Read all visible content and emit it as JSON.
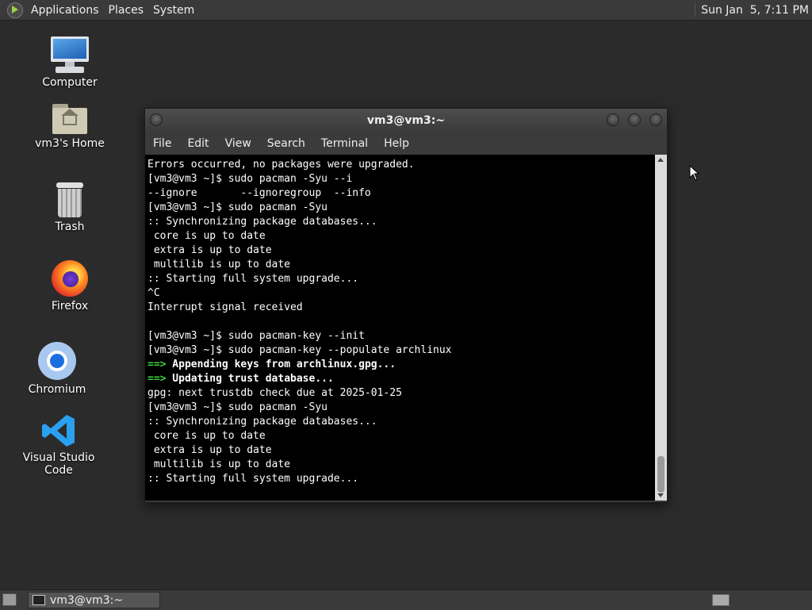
{
  "top_panel": {
    "menus": [
      "Applications",
      "Places",
      "System"
    ],
    "clock": "Sun Jan  5, 7:11 PM"
  },
  "desktop_icons": {
    "computer": "Computer",
    "home": "vm3's Home",
    "trash": "Trash",
    "firefox": "Firefox",
    "chromium": "Chromium",
    "vscode": "Visual Studio Code"
  },
  "terminal": {
    "title": "vm3@vm3:~",
    "menu": [
      "File",
      "Edit",
      "View",
      "Search",
      "Terminal",
      "Help"
    ],
    "lines": [
      {
        "text": "Errors occurred, no packages were upgraded."
      },
      {
        "text": "[vm3@vm3 ~]$ sudo pacman -Syu --i"
      },
      {
        "text": "--ignore       --ignoregroup  --info"
      },
      {
        "text": "[vm3@vm3 ~]$ sudo pacman -Syu"
      },
      {
        "text": ":: Synchronizing package databases..."
      },
      {
        "text": " core is up to date"
      },
      {
        "text": " extra is up to date"
      },
      {
        "text": " multilib is up to date"
      },
      {
        "text": ":: Starting full system upgrade..."
      },
      {
        "text": "^C"
      },
      {
        "text": "Interrupt signal received"
      },
      {
        "text": ""
      },
      {
        "text": "[vm3@vm3 ~]$ sudo pacman-key --init"
      },
      {
        "text": "[vm3@vm3 ~]$ sudo pacman-key --populate archlinux"
      },
      {
        "prefix": "==>",
        "text": " Appending keys from archlinux.gpg...",
        "bold": true
      },
      {
        "prefix": "==>",
        "text": " Updating trust database...",
        "bold": true
      },
      {
        "text": "gpg: next trustdb check due at 2025-01-25"
      },
      {
        "text": "[vm3@vm3 ~]$ sudo pacman -Syu"
      },
      {
        "text": ":: Synchronizing package databases..."
      },
      {
        "text": " core is up to date"
      },
      {
        "text": " extra is up to date"
      },
      {
        "text": " multilib is up to date"
      },
      {
        "text": ":: Starting full system upgrade..."
      }
    ]
  },
  "taskbar": {
    "task": "vm3@vm3:~"
  },
  "colors": {
    "prompt_arrow": "#3ad83a",
    "terminal_bg": "#000000",
    "desktop_bg": "#2b2b2b"
  }
}
